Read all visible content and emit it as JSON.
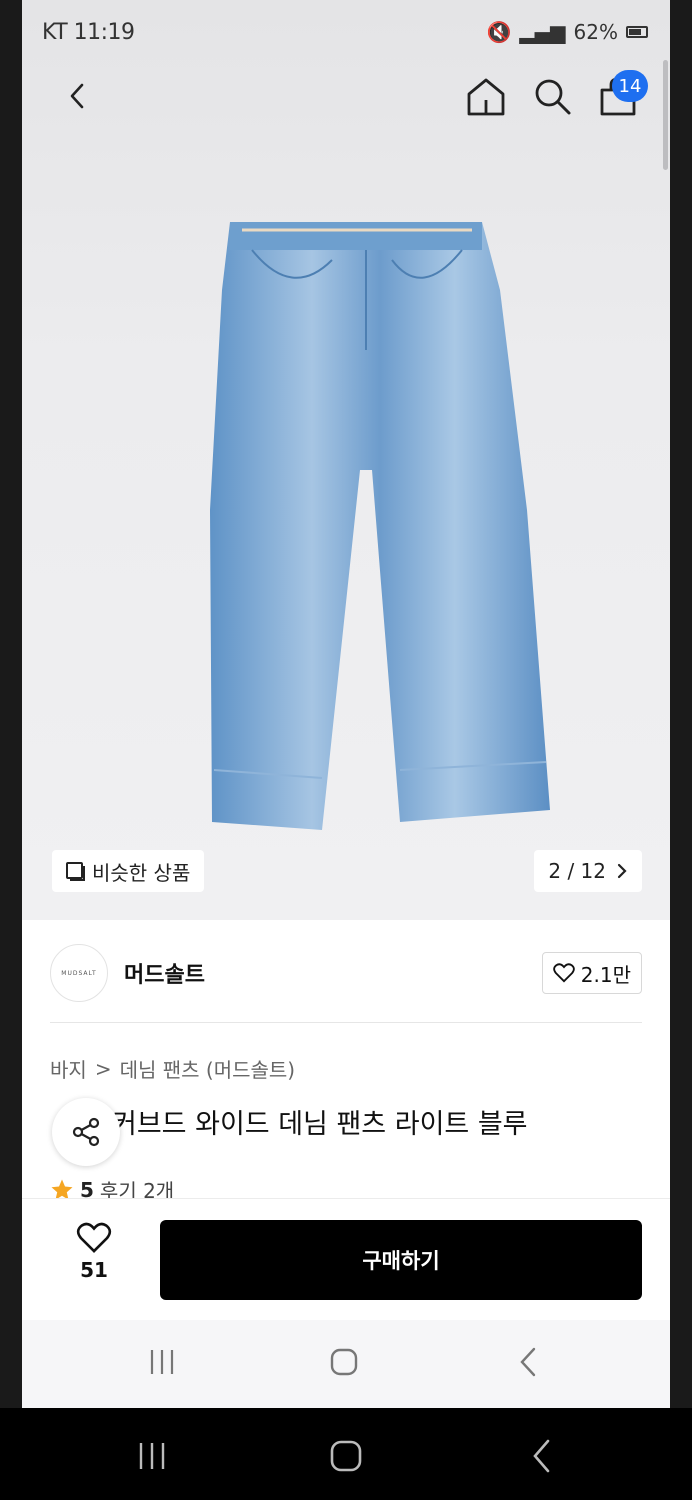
{
  "status_bar": {
    "time": "KT 11:19",
    "battery": "62%"
  },
  "header": {
    "cart_count": "14"
  },
  "gallery": {
    "similar_label": "비슷한 상품",
    "page_indicator": "2 / 12"
  },
  "brand": {
    "logo_text": "MUDSALT",
    "name": "머드솔트",
    "likes": "2.1만"
  },
  "breadcrumb": {
    "level1": "바지",
    "separator": ">",
    "level2": "데님 팬츠 (머드솔트)"
  },
  "product": {
    "title": "커브드 와이드 데님 팬츠 라이트 블루"
  },
  "rating": {
    "score": "5",
    "reviews": "후기 2개"
  },
  "bottom": {
    "wish_count": "51",
    "buy_label": "구매하기"
  },
  "colors": {
    "accent_badge": "#1e6ff0",
    "buy_button": "#000000",
    "star": "#f5a623"
  },
  "icons": [
    "back-icon",
    "home-icon",
    "search-icon",
    "cart-icon",
    "share-icon",
    "heart-icon",
    "star-icon"
  ]
}
